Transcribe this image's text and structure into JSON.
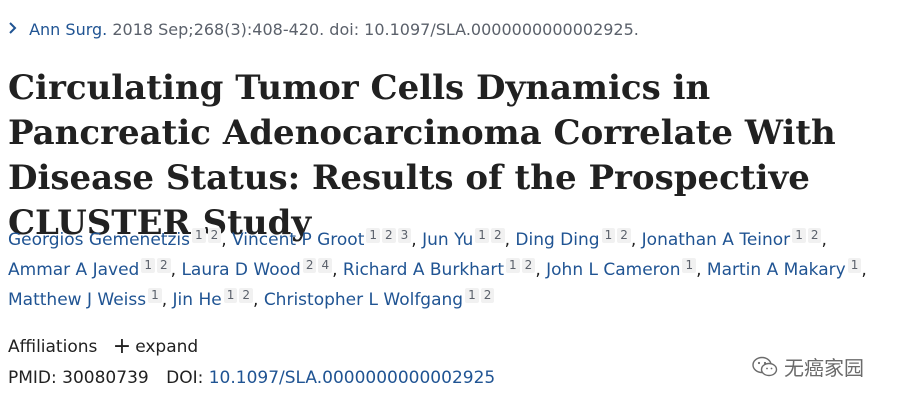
{
  "citation": {
    "journal": "Ann Surg.",
    "details": " 2018 Sep;268(3):408-420. doi: 10.1097/SLA.0000000000002925."
  },
  "title": "Circulating Tumor Cells Dynamics in Pancreatic Adenocarcinoma Correlate With Disease Status: Results of the Prospective CLUSTER Study",
  "authors": [
    {
      "name": "Georgios Gemenetzis",
      "affs": [
        "1",
        "2"
      ]
    },
    {
      "name": "Vincent P Groot",
      "affs": [
        "1",
        "2",
        "3"
      ]
    },
    {
      "name": "Jun Yu",
      "affs": [
        "1",
        "2"
      ]
    },
    {
      "name": "Ding Ding",
      "affs": [
        "1",
        "2"
      ]
    },
    {
      "name": "Jonathan A Teinor",
      "affs": [
        "1",
        "2"
      ]
    },
    {
      "name": "Ammar A Javed",
      "affs": [
        "1",
        "2"
      ]
    },
    {
      "name": "Laura D Wood",
      "affs": [
        "2",
        "4"
      ]
    },
    {
      "name": "Richard A Burkhart",
      "affs": [
        "1",
        "2"
      ]
    },
    {
      "name": "John L Cameron",
      "affs": [
        "1"
      ]
    },
    {
      "name": "Martin A Makary",
      "affs": [
        "1"
      ]
    },
    {
      "name": "Matthew J Weiss",
      "affs": [
        "1"
      ]
    },
    {
      "name": "Jin He",
      "affs": [
        "1",
        "2"
      ]
    },
    {
      "name": "Christopher L Wolfgang",
      "affs": [
        "1",
        "2"
      ]
    }
  ],
  "affiliations": {
    "label": "Affiliations",
    "expand_label": "expand"
  },
  "ids": {
    "pmid_label": "PMID:",
    "pmid": "30080739",
    "doi_label": "DOI:",
    "doi": "10.1097/SLA.0000000000002925"
  },
  "watermark": {
    "text": "无癌家园"
  },
  "colors": {
    "link": "#205493",
    "text": "#212121",
    "muted": "#5b616b"
  }
}
